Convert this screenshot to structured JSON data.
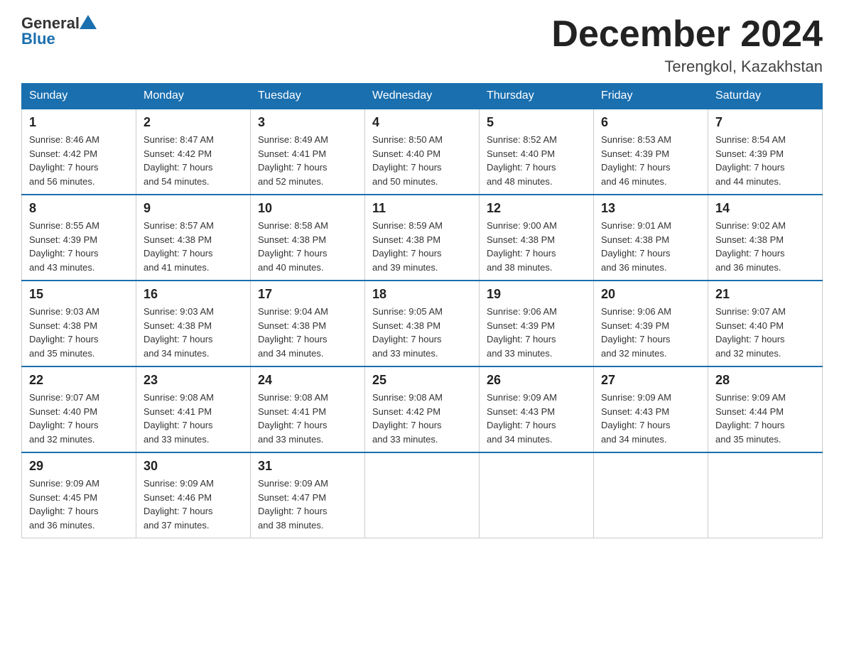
{
  "header": {
    "logo_general": "General",
    "logo_blue": "Blue",
    "title": "December 2024",
    "subtitle": "Terengkol, Kazakhstan"
  },
  "days_of_week": [
    "Sunday",
    "Monday",
    "Tuesday",
    "Wednesday",
    "Thursday",
    "Friday",
    "Saturday"
  ],
  "weeks": [
    [
      {
        "num": "1",
        "info": "Sunrise: 8:46 AM\nSunset: 4:42 PM\nDaylight: 7 hours\nand 56 minutes."
      },
      {
        "num": "2",
        "info": "Sunrise: 8:47 AM\nSunset: 4:42 PM\nDaylight: 7 hours\nand 54 minutes."
      },
      {
        "num": "3",
        "info": "Sunrise: 8:49 AM\nSunset: 4:41 PM\nDaylight: 7 hours\nand 52 minutes."
      },
      {
        "num": "4",
        "info": "Sunrise: 8:50 AM\nSunset: 4:40 PM\nDaylight: 7 hours\nand 50 minutes."
      },
      {
        "num": "5",
        "info": "Sunrise: 8:52 AM\nSunset: 4:40 PM\nDaylight: 7 hours\nand 48 minutes."
      },
      {
        "num": "6",
        "info": "Sunrise: 8:53 AM\nSunset: 4:39 PM\nDaylight: 7 hours\nand 46 minutes."
      },
      {
        "num": "7",
        "info": "Sunrise: 8:54 AM\nSunset: 4:39 PM\nDaylight: 7 hours\nand 44 minutes."
      }
    ],
    [
      {
        "num": "8",
        "info": "Sunrise: 8:55 AM\nSunset: 4:39 PM\nDaylight: 7 hours\nand 43 minutes."
      },
      {
        "num": "9",
        "info": "Sunrise: 8:57 AM\nSunset: 4:38 PM\nDaylight: 7 hours\nand 41 minutes."
      },
      {
        "num": "10",
        "info": "Sunrise: 8:58 AM\nSunset: 4:38 PM\nDaylight: 7 hours\nand 40 minutes."
      },
      {
        "num": "11",
        "info": "Sunrise: 8:59 AM\nSunset: 4:38 PM\nDaylight: 7 hours\nand 39 minutes."
      },
      {
        "num": "12",
        "info": "Sunrise: 9:00 AM\nSunset: 4:38 PM\nDaylight: 7 hours\nand 38 minutes."
      },
      {
        "num": "13",
        "info": "Sunrise: 9:01 AM\nSunset: 4:38 PM\nDaylight: 7 hours\nand 36 minutes."
      },
      {
        "num": "14",
        "info": "Sunrise: 9:02 AM\nSunset: 4:38 PM\nDaylight: 7 hours\nand 36 minutes."
      }
    ],
    [
      {
        "num": "15",
        "info": "Sunrise: 9:03 AM\nSunset: 4:38 PM\nDaylight: 7 hours\nand 35 minutes."
      },
      {
        "num": "16",
        "info": "Sunrise: 9:03 AM\nSunset: 4:38 PM\nDaylight: 7 hours\nand 34 minutes."
      },
      {
        "num": "17",
        "info": "Sunrise: 9:04 AM\nSunset: 4:38 PM\nDaylight: 7 hours\nand 34 minutes."
      },
      {
        "num": "18",
        "info": "Sunrise: 9:05 AM\nSunset: 4:38 PM\nDaylight: 7 hours\nand 33 minutes."
      },
      {
        "num": "19",
        "info": "Sunrise: 9:06 AM\nSunset: 4:39 PM\nDaylight: 7 hours\nand 33 minutes."
      },
      {
        "num": "20",
        "info": "Sunrise: 9:06 AM\nSunset: 4:39 PM\nDaylight: 7 hours\nand 32 minutes."
      },
      {
        "num": "21",
        "info": "Sunrise: 9:07 AM\nSunset: 4:40 PM\nDaylight: 7 hours\nand 32 minutes."
      }
    ],
    [
      {
        "num": "22",
        "info": "Sunrise: 9:07 AM\nSunset: 4:40 PM\nDaylight: 7 hours\nand 32 minutes."
      },
      {
        "num": "23",
        "info": "Sunrise: 9:08 AM\nSunset: 4:41 PM\nDaylight: 7 hours\nand 33 minutes."
      },
      {
        "num": "24",
        "info": "Sunrise: 9:08 AM\nSunset: 4:41 PM\nDaylight: 7 hours\nand 33 minutes."
      },
      {
        "num": "25",
        "info": "Sunrise: 9:08 AM\nSunset: 4:42 PM\nDaylight: 7 hours\nand 33 minutes."
      },
      {
        "num": "26",
        "info": "Sunrise: 9:09 AM\nSunset: 4:43 PM\nDaylight: 7 hours\nand 34 minutes."
      },
      {
        "num": "27",
        "info": "Sunrise: 9:09 AM\nSunset: 4:43 PM\nDaylight: 7 hours\nand 34 minutes."
      },
      {
        "num": "28",
        "info": "Sunrise: 9:09 AM\nSunset: 4:44 PM\nDaylight: 7 hours\nand 35 minutes."
      }
    ],
    [
      {
        "num": "29",
        "info": "Sunrise: 9:09 AM\nSunset: 4:45 PM\nDaylight: 7 hours\nand 36 minutes."
      },
      {
        "num": "30",
        "info": "Sunrise: 9:09 AM\nSunset: 4:46 PM\nDaylight: 7 hours\nand 37 minutes."
      },
      {
        "num": "31",
        "info": "Sunrise: 9:09 AM\nSunset: 4:47 PM\nDaylight: 7 hours\nand 38 minutes."
      },
      null,
      null,
      null,
      null
    ]
  ]
}
